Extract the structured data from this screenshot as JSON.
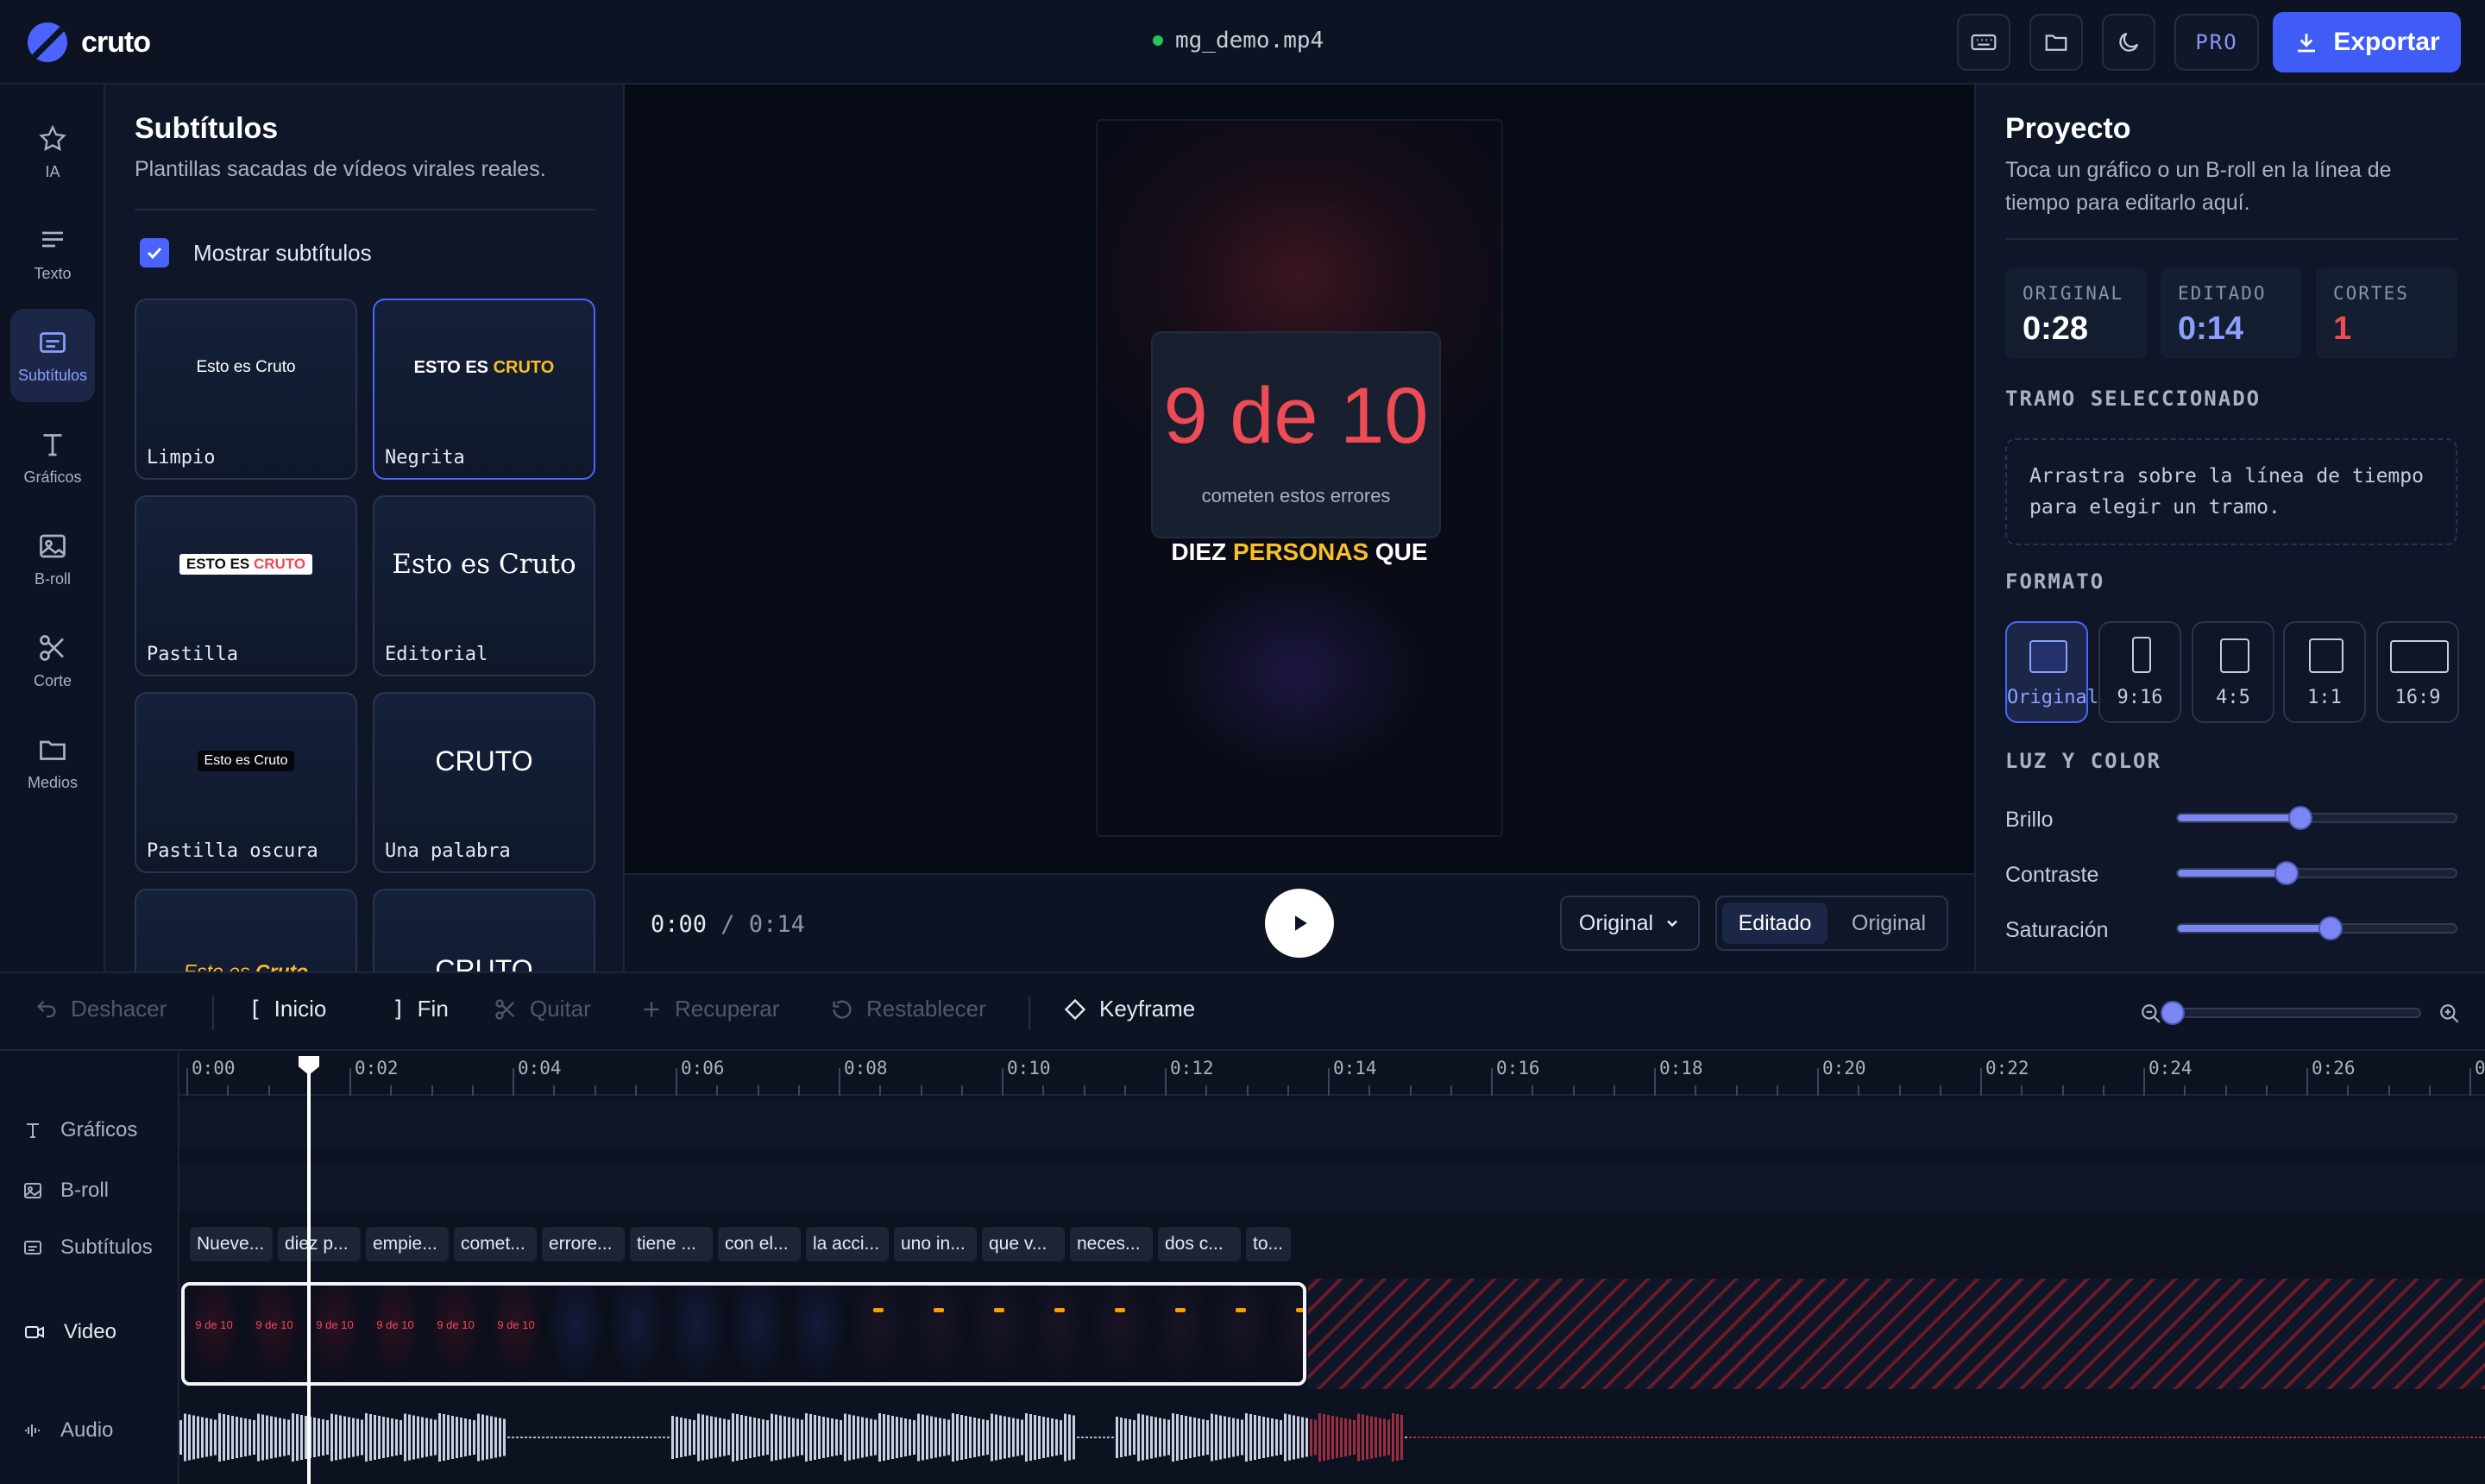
{
  "app": {
    "name": "cruto",
    "filename": "mg_demo.mp4",
    "pro": "PRO",
    "export": "Exportar"
  },
  "rail": [
    {
      "label": "IA",
      "icon": "star-icon"
    },
    {
      "label": "Texto",
      "icon": "lines-icon"
    },
    {
      "label": "Subtítulos",
      "icon": "subtitles-icon",
      "active": true
    },
    {
      "label": "Gráficos",
      "icon": "type-icon"
    },
    {
      "label": "B-roll",
      "icon": "image-icon"
    },
    {
      "label": "Corte",
      "icon": "scissors-icon"
    },
    {
      "label": "Medios",
      "icon": "folder-icon"
    }
  ],
  "subtitles": {
    "title": "Subtítulos",
    "subtitle": "Plantillas sacadas de vídeos virales reales.",
    "show_label": "Mostrar subtítulos",
    "show_checked": true,
    "templates": [
      {
        "name": "Limpio",
        "preview": "Esto es Cruto"
      },
      {
        "name": "Negrita",
        "preview_a": "ESTO ES ",
        "preview_b": "CRUTO"
      },
      {
        "name": "Pastilla",
        "preview_a": "ESTO ES ",
        "preview_b": "CRUTO"
      },
      {
        "name": "Editorial",
        "preview": "Esto es Cruto"
      },
      {
        "name": "Pastilla oscura",
        "preview": "Esto es Cruto"
      },
      {
        "name": "Una palabra",
        "preview": "CRUTO"
      },
      {
        "preview_a": "Esto es ",
        "preview_b": "Cruto"
      },
      {
        "preview": "CRUTO"
      }
    ]
  },
  "preview": {
    "big_number": "9 de 10",
    "card_caption": "cometen estos errores",
    "caption_a": "DIEZ ",
    "caption_hl": "PERSONAS",
    "caption_b": " QUE",
    "time_current": "0:00",
    "time_sep": "/",
    "time_total": "0:14",
    "format_select": "Original",
    "view_active": "Editado",
    "view_other": "Original"
  },
  "project": {
    "title": "Proyecto",
    "subtitle": "Toca un gráfico o un B-roll en la línea de tiempo para editarlo aquí.",
    "stats": [
      {
        "label": "ORIGINAL",
        "value": "0:28",
        "color": "#ffffff"
      },
      {
        "label": "EDITADO",
        "value": "0:14",
        "color": "#8aa0ff"
      },
      {
        "label": "CORTES",
        "value": "1",
        "color": "#ef4b55"
      }
    ],
    "tramo_title": "TRAMO SELECCIONADO",
    "tramo_text": "Arrastra sobre la línea de tiempo para elegir un tramo.",
    "formato_title": "FORMATO",
    "formats": [
      "Original",
      "9:16",
      "4:5",
      "1:1",
      "16:9"
    ],
    "luz_title": "LUZ Y COLOR",
    "sliders": [
      {
        "label": "Brillo",
        "value": 0.44
      },
      {
        "label": "Contraste",
        "value": 0.39
      },
      {
        "label": "Saturación",
        "value": 0.55
      }
    ]
  },
  "toolbar": {
    "undo": "Deshacer",
    "start": "Inicio",
    "end": "Fin",
    "remove": "Quitar",
    "restore": "Recuperar",
    "reset": "Restablecer",
    "keyframe": "Keyframe",
    "zoom_value": 0
  },
  "timeline": {
    "tracks": [
      "Gráficos",
      "B-roll",
      "Subtítulos",
      "Video",
      "Audio"
    ],
    "ruler": [
      "0:00",
      "0:02",
      "0:04",
      "0:06",
      "0:08",
      "0:10",
      "0:12",
      "0:14",
      "0:16",
      "0:18",
      "0:20",
      "0:22",
      "0:24",
      "0:26",
      "0"
    ],
    "subtitle_chips": [
      "Nueve...",
      "diez p...",
      "empie...",
      "comet...",
      "errore...",
      "tiene ...",
      "con el...",
      "la acci...",
      "uno in...",
      "que v...",
      "neces...",
      "dos c...",
      "to..."
    ],
    "playhead_time": 1.5,
    "kept_seconds": 14,
    "total_seconds": 28,
    "thumb_text": "9 de 10",
    "accent": "#4b63ff",
    "cut_color": "#ef4b55"
  }
}
